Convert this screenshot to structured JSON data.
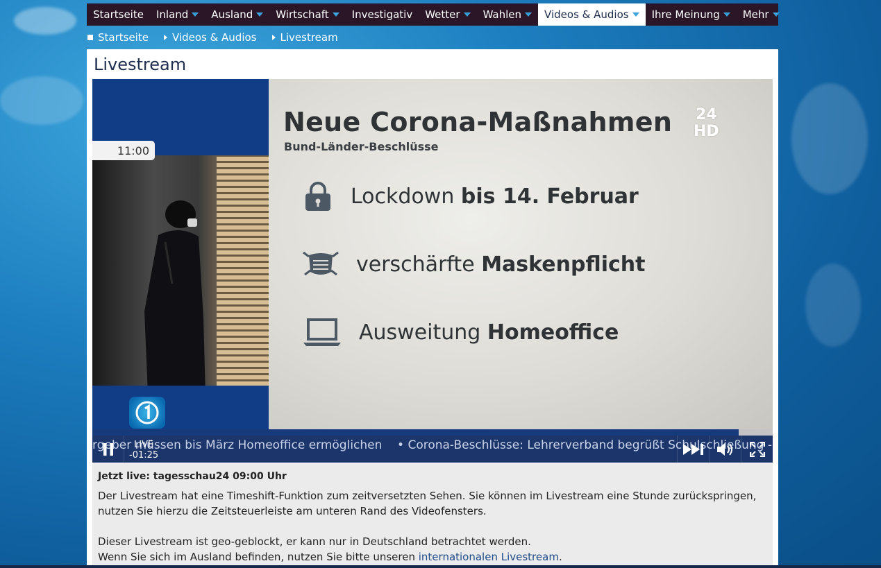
{
  "nav": {
    "items": [
      {
        "label": "Startseite",
        "caret": false
      },
      {
        "label": "Inland",
        "caret": true
      },
      {
        "label": "Ausland",
        "caret": true
      },
      {
        "label": "Wirtschaft",
        "caret": true
      },
      {
        "label": "Investigativ",
        "caret": false
      },
      {
        "label": "Wetter",
        "caret": true
      },
      {
        "label": "Wahlen",
        "caret": true
      },
      {
        "label": "Videos & Audios",
        "caret": true,
        "active": true
      },
      {
        "label": "Ihre Meinung",
        "caret": true
      },
      {
        "label": "Mehr",
        "caret": true
      }
    ]
  },
  "breadcrumb": [
    "Startseite",
    "Videos & Audios",
    "Livestream"
  ],
  "page": {
    "title": "Livestream"
  },
  "player": {
    "clock": "11:00",
    "slide": {
      "title": "Neue Corona-Maßnahmen",
      "subtitle": "Bund-Länder-Beschlüsse",
      "channel_logo": {
        "top": "24",
        "bottom": "HD"
      },
      "bullets": [
        {
          "icon": "lock-icon",
          "normal": "Lockdown ",
          "bold": "bis 14. Februar"
        },
        {
          "icon": "mask-icon",
          "normal": "verschärfte ",
          "bold": "Maskenpflicht"
        },
        {
          "icon": "laptop-icon",
          "normal": "Ausweitung ",
          "bold": "Homeoffice"
        }
      ]
    },
    "progress": 0.95,
    "ticker": "rgeber müssen bis März Homeoffice ermöglichen    • Corona-Beschlüsse: Lehrerverband begrüßt Schulschließung - Kritik von Me",
    "live_label": "LIVE",
    "time_offset": "-01:25"
  },
  "info": {
    "heading": "Jetzt live: tagesschau24 09:00 Uhr",
    "para1": "Der Livestream hat eine Timeshift-Funktion zum zeitversetzten Sehen. Sie können im Livestream eine Stunde zurückspringen, nutzen Sie hierzu die Zeitsteuerleiste am unteren Rand des Videofensters.",
    "para2a": "Dieser Livestream ist geo-geblockt, er kann nur in Deutschland betrachtet werden.",
    "para2b": "Wenn Sie sich im Ausland befinden, nutzen Sie bitte unseren ",
    "link": "internationalen Livestream",
    "para2c": "."
  },
  "colors": {
    "nav_bg": "#2b1628",
    "accent": "#3aa2de",
    "title": "#1e2d4d"
  }
}
